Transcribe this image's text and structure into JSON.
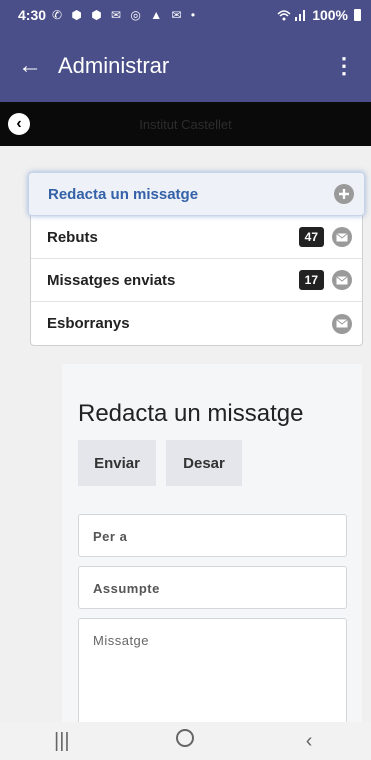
{
  "status_bar": {
    "time": "4:30",
    "notification_icons": "✆ ⬢ ⬢ ✉ ◎ ▲ ✉ •",
    "signal_icons": "wifi-signal-icon",
    "battery": "100%"
  },
  "app_bar": {
    "title": "Administrar"
  },
  "school_bar": {
    "name": "Institut Castellet"
  },
  "mail_menu": {
    "items": [
      {
        "label": "Redacta un missatge",
        "icon": "plus-circle-icon"
      },
      {
        "label": "Rebuts",
        "count": "47",
        "icon": "envelope-icon"
      },
      {
        "label": "Missatges enviats",
        "count": "17",
        "icon": "envelope-icon"
      },
      {
        "label": "Esborranys",
        "icon": "envelope-icon"
      }
    ]
  },
  "compose": {
    "title": "Redacta un missatge",
    "send_label": "Enviar",
    "save_label": "Desar",
    "to_placeholder": "Per a",
    "subject_placeholder": "Assumpte",
    "message_placeholder": "Missatge"
  },
  "colors": {
    "header": "#4a4f89",
    "active_text": "#3461a8",
    "school_bar": "#0a0a0a"
  }
}
